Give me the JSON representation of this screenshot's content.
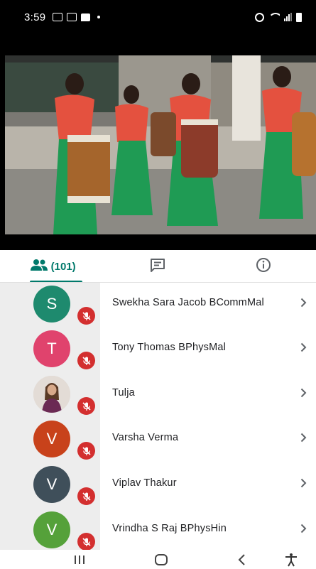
{
  "status_bar": {
    "time": "3:59",
    "left_icons": [
      "image-icon",
      "gallery-icon",
      "message-icon",
      "dot-icon"
    ],
    "right_icons": [
      "alarm-icon",
      "wifi-icon",
      "signal-icon",
      "battery-icon"
    ]
  },
  "video": {
    "description_icon": "video-feed"
  },
  "tabs": [
    {
      "icon": "people-icon",
      "label": "(101)",
      "active": true
    },
    {
      "icon": "chat-icon",
      "label": "",
      "active": false
    },
    {
      "icon": "info-icon",
      "label": "",
      "active": false
    }
  ],
  "participants": [
    {
      "initial": "S",
      "name": "Swekha Sara Jacob BCommMal",
      "avatar_color": "#1e8a6e",
      "muted": true
    },
    {
      "initial": "T",
      "name": "Tony Thomas BPhysMal",
      "avatar_color": "#e0436d",
      "muted": true
    },
    {
      "initial": "",
      "name": "Tulja",
      "avatar_color": "#d9d0cc",
      "muted": true,
      "photo": true
    },
    {
      "initial": "V",
      "name": "Varsha Verma",
      "avatar_color": "#c8421b",
      "muted": true
    },
    {
      "initial": "V",
      "name": "Viplav Thakur",
      "avatar_color": "#3f4f5a",
      "muted": true
    },
    {
      "initial": "V",
      "name": "Vrindha S Raj BPhysHin",
      "avatar_color": "#55a13a",
      "muted": true
    }
  ],
  "colors": {
    "accent": "#00796b",
    "mute_badge": "#d32f2f"
  },
  "nav_bar": {
    "buttons": [
      "recents-icon",
      "home-icon",
      "back-icon",
      "accessibility-icon"
    ]
  }
}
